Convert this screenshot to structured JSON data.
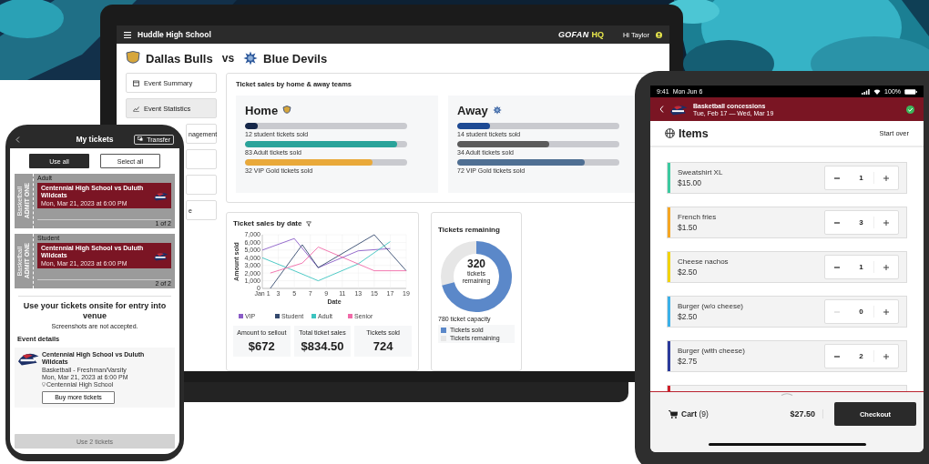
{
  "laptop": {
    "header": {
      "school": "Huddle High School",
      "brand": "GOFAN",
      "brand_suffix": "HQ",
      "greeting": "Hi Taylor"
    },
    "matchup": {
      "home": "Dallas Bulls",
      "separator": "vs",
      "away": "Blue Devils"
    },
    "sidebar": {
      "items": [
        {
          "label": "Event Summary",
          "kind": "calendar",
          "selected": false
        },
        {
          "label": "Event Statistics",
          "kind": "chart",
          "selected": true
        },
        {
          "label": "nagement",
          "kind": "plain",
          "selected": false
        },
        {
          "kind": "plain",
          "selected": false
        },
        {
          "kind": "plain",
          "selected": false
        },
        {
          "label": "e",
          "kind": "plain",
          "selected": false
        }
      ]
    },
    "team_sales": {
      "title": "Ticket sales by home & away teams",
      "teams": [
        {
          "name": "Home",
          "kind": "shield",
          "bars": [
            {
              "level": 0.08,
              "color": "#16284a",
              "caption": "12 student tickets sold"
            },
            {
              "level": 0.94,
              "color": "#2aa39a",
              "caption": "83 Adult tickets sold"
            },
            {
              "level": 0.79,
              "color": "#e9a93a",
              "caption": "32 VIP Gold tickets sold"
            }
          ]
        },
        {
          "name": "Away",
          "kind": "star",
          "bars": [
            {
              "level": 0.2,
              "color": "#1d4a94",
              "caption": "14 student tickets sold"
            },
            {
              "level": 0.57,
              "color": "#5b5b5b",
              "caption": "34 Adult tickets sold"
            },
            {
              "level": 0.79,
              "color": "#4f6f93",
              "caption": "72 VIP Gold tickets sold"
            }
          ]
        }
      ]
    },
    "date_chart": {
      "title": "Ticket sales by date",
      "chart_data": {
        "type": "line",
        "xlabel": "Date",
        "ylabel": "Amount sold",
        "x": [
          1,
          2,
          5,
          6,
          8,
          13,
          15,
          17,
          19
        ],
        "series": [
          {
            "name": "VIP",
            "color": "#8a5cc7",
            "values": [
              5000,
              null,
              6500,
              null,
              2700,
              4900,
              null,
              5200,
              null
            ]
          },
          {
            "name": "Student",
            "color": "#34496e",
            "values": [
              null,
              0,
              null,
              5700,
              2700,
              null,
              7000,
              null,
              2300
            ]
          },
          {
            "name": "Adult",
            "color": "#3cc4c0",
            "values": [
              4000,
              null,
              2300,
              null,
              1000,
              3200,
              null,
              6100,
              null
            ]
          },
          {
            "name": "Senior",
            "color": "#f06aa8",
            "values": [
              null,
              2000,
              null,
              3300,
              5400,
              null,
              2300,
              null,
              2300
            ]
          }
        ],
        "xlim": [
          1,
          19
        ],
        "ylim": [
          0,
          7000
        ],
        "grid": true,
        "legend": "bottom",
        "xticks": [
          {
            "value": 1,
            "label": "Jan 1"
          },
          3,
          5,
          7,
          9,
          11,
          13,
          15,
          17,
          19
        ],
        "yticks": [
          0,
          {
            "value": 1000,
            "label": "1,000"
          },
          {
            "value": 2000,
            "label": "2,000"
          },
          {
            "value": 3000,
            "label": "3,000"
          },
          {
            "value": 4000,
            "label": "4,000"
          },
          {
            "value": 5000,
            "label": "5,000"
          },
          {
            "value": 6000,
            "label": "6,000"
          },
          {
            "value": 7000,
            "label": "7,000"
          }
        ]
      }
    },
    "stats": [
      {
        "label": "Amount to sellout",
        "value": "$672"
      },
      {
        "label": "Total ticket sales",
        "value": "$834.50"
      },
      {
        "label": "Tickets sold",
        "value": "724"
      }
    ],
    "remaining": {
      "title": "Tickets remaining",
      "center_value": "320",
      "center_label": "tickets remaining",
      "capacity": "780 ticket capacity",
      "legend": [
        {
          "label": "Tickets sold",
          "color": "#5b88c9"
        },
        {
          "label": "Tickets remaining",
          "color": "#e6e6e6"
        }
      ]
    }
  },
  "phone": {
    "title": "My tickets",
    "transfer": "Transfer",
    "actions": [
      {
        "label": "Use all",
        "kind": "primary"
      },
      {
        "label": "Select all",
        "kind": "secondary"
      }
    ],
    "tickets": [
      {
        "type": "Adult",
        "stub": "ADMIT ONE",
        "stub_sub": "Basketball",
        "event": "Centennial High School vs Duluth Wildcats",
        "date": "Mon, Mar 21, 2023 at 6:00 PM",
        "count": "1 of 2"
      },
      {
        "type": "Student",
        "stub": "ADMIT ONE",
        "stub_sub": "Basketball",
        "event": "Centennial High School vs Duluth Wildcats",
        "date": "Mon, Mar 21, 2023 at 6:00 PM",
        "count": "2 of 2"
      }
    ],
    "notice": "Use your tickets onsite for entry into venue",
    "note": "Screenshots are not accepted.",
    "details_heading": "Event details",
    "event": {
      "name": "Centennial High School vs Duluth Wildcats",
      "sport": "Basketball - Freshman/Varsity",
      "date": "Mon, Mar 21, 2023 at 6:00 PM",
      "venue": "Centennial High School",
      "button": "Buy more tickets"
    },
    "submit": {
      "label": "Use 2 tickets",
      "disabled": true
    }
  },
  "tablet": {
    "status": {
      "time": "9:41",
      "date": "Mon Jun 6",
      "battery": "100%"
    },
    "header": {
      "title": "Basketball concessions",
      "dates": "Tue, Feb 17 — Wed, Mar 19",
      "complete": true
    },
    "section": {
      "title": "Items",
      "action": "Start over"
    },
    "items": [
      {
        "name": "Sweatshirt XL",
        "price": "$15.00",
        "qty": "1",
        "color": "#3cc9a0",
        "decrease_disabled": false
      },
      {
        "name": "French fries",
        "price": "$1.50",
        "qty": "3",
        "color": "#f5a623",
        "decrease_disabled": false
      },
      {
        "name": "Cheese nachos",
        "price": "$2.50",
        "qty": "1",
        "color": "#f2d300",
        "decrease_disabled": false
      },
      {
        "name": "Burger (w/o cheese)",
        "price": "$2.50",
        "qty": "0",
        "color": "#3bb0e8",
        "decrease_disabled": true
      },
      {
        "name": "Burger (with cheese)",
        "price": "$2.75",
        "qty": "2",
        "color": "#2b3a9b",
        "decrease_disabled": false
      },
      {
        "color": "#d0202a"
      }
    ],
    "cart": {
      "label": "**Cart** (9)",
      "total": "$27.50",
      "checkout": "Checkout"
    }
  }
}
